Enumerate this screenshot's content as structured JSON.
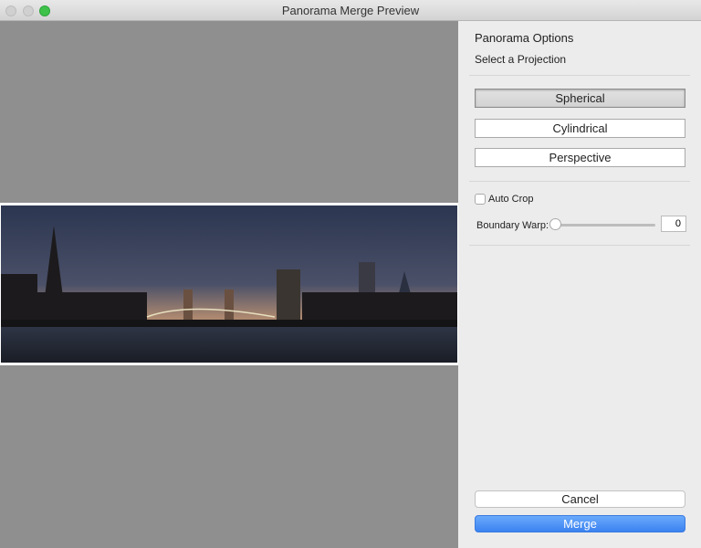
{
  "window": {
    "title": "Panorama Merge Preview"
  },
  "panel": {
    "heading": "Panorama Options",
    "projection_label": "Select a Projection",
    "projections": [
      {
        "label": "Spherical",
        "selected": true
      },
      {
        "label": "Cylindrical",
        "selected": false
      },
      {
        "label": "Perspective",
        "selected": false
      }
    ],
    "auto_crop": {
      "label": "Auto Crop",
      "checked": false
    },
    "boundary_warp": {
      "label": "Boundary Warp:",
      "value": "0"
    },
    "cancel_label": "Cancel",
    "merge_label": "Merge"
  },
  "colors": {
    "accent": "#3b82f0",
    "preview_bg": "#8f8f8f"
  }
}
